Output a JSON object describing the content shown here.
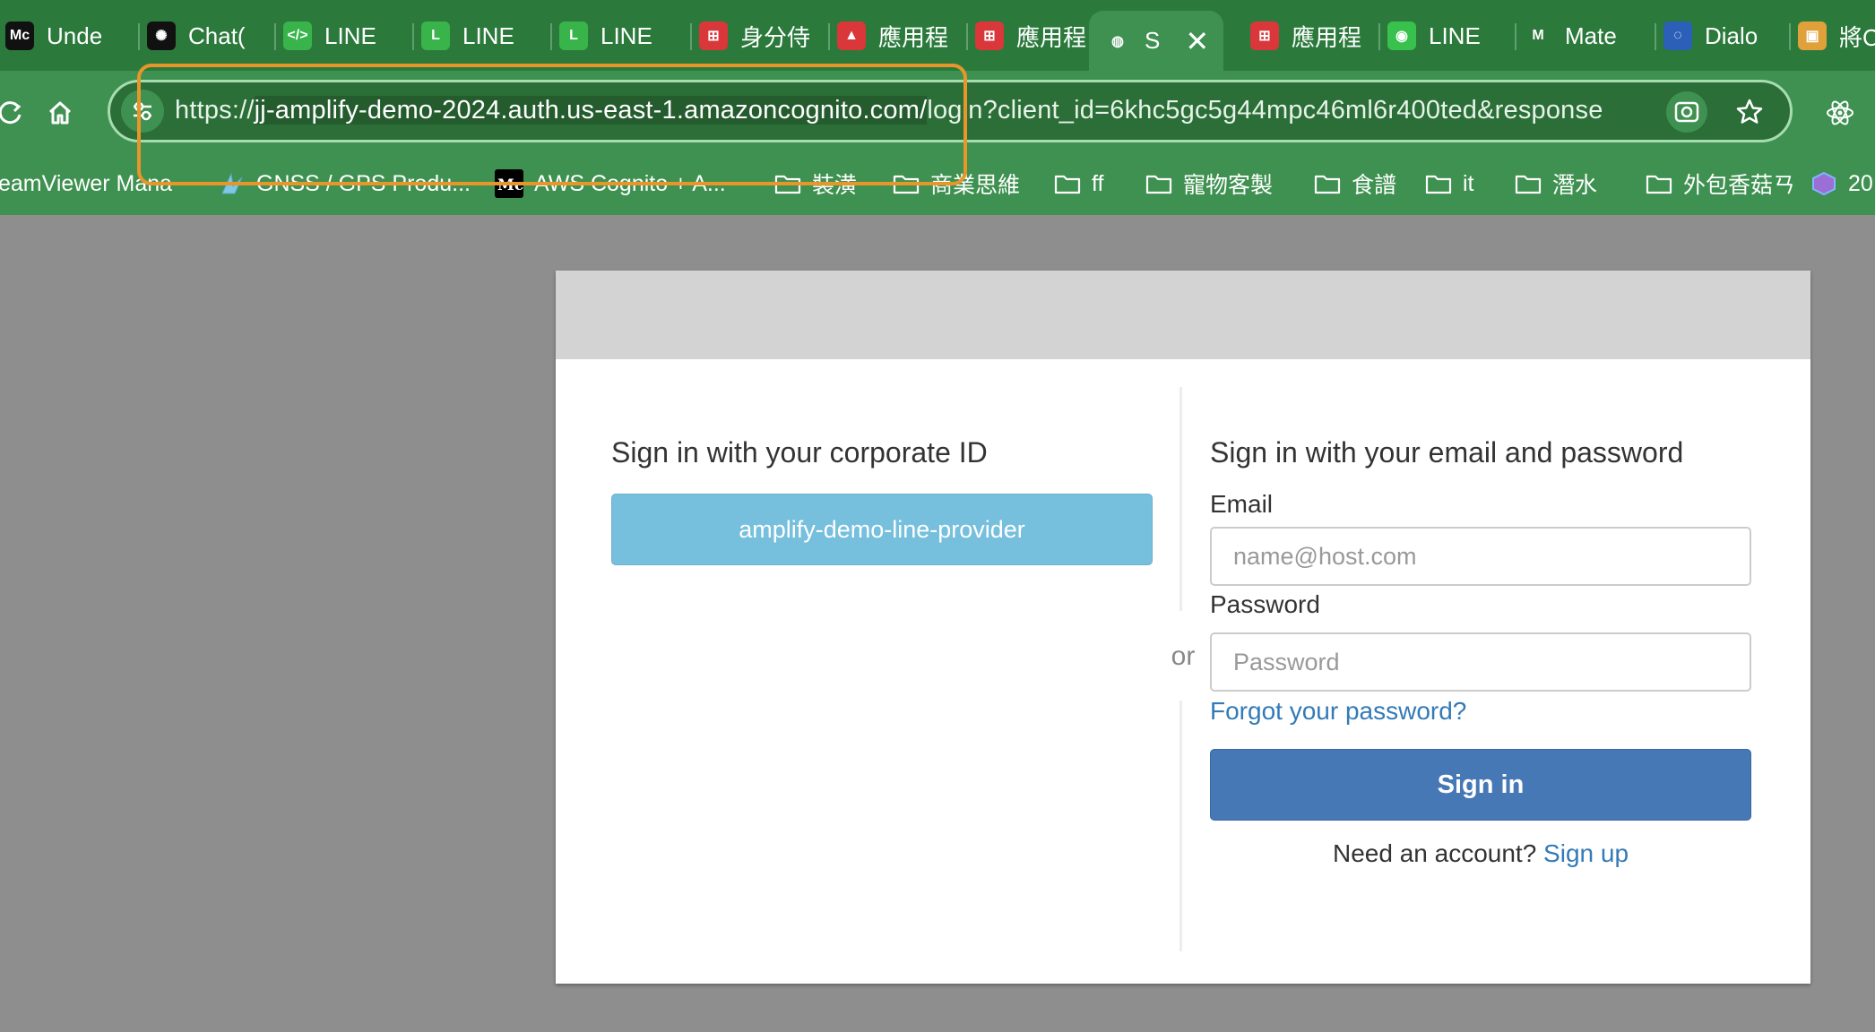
{
  "browser": {
    "tabs": [
      {
        "label": "Unde",
        "icon": "medium-icon",
        "icon_text": "Mc",
        "icon_bg": "#111111"
      },
      {
        "label": "Chat(",
        "icon": "chatgpt-icon",
        "icon_text": "✺",
        "icon_bg": "#111111"
      },
      {
        "label": "LINE",
        "icon": "line-dev-code-icon",
        "icon_text": "</>",
        "icon_bg": "#38b44a"
      },
      {
        "label": "LINE",
        "icon": "line-shield-icon",
        "icon_text": "L",
        "icon_bg": "#38b44a"
      },
      {
        "label": "LINE",
        "icon": "line-shield-icon",
        "icon_text": "L",
        "icon_bg": "#38b44a"
      },
      {
        "label": "身分侍",
        "icon": "app-red-icon",
        "icon_text": "⊞",
        "icon_bg": "#d9373a"
      },
      {
        "label": "應用程",
        "icon": "amplify-icon",
        "icon_text": "▲",
        "icon_bg": "#d9373a"
      },
      {
        "label": "應用程",
        "icon": "app-red-icon",
        "icon_text": "⊞",
        "icon_bg": "#d9373a"
      },
      {
        "label": "S",
        "icon": "globe-icon",
        "icon_text": "◍",
        "icon_bg": "transparent",
        "active": true
      },
      {
        "label": "應用程",
        "icon": "app-red-icon",
        "icon_text": "⊞",
        "icon_bg": "#d9373a"
      },
      {
        "label": "LINE",
        "icon": "line-chat-icon",
        "icon_text": "◉",
        "icon_bg": "#38c14c"
      },
      {
        "label": "Mate",
        "icon": "material-icon",
        "icon_text": "M",
        "icon_bg": "#2b7a3c"
      },
      {
        "label": "Dialo",
        "icon": "dialogflow-icon",
        "icon_text": "◌",
        "icon_bg": "#2c5fb8"
      },
      {
        "label": "將C",
        "icon": "package-icon",
        "icon_text": "▣",
        "icon_bg": "#e0a13a"
      }
    ],
    "close_glyph": "✕",
    "url_prefix": "https://",
    "url_host": "jj-amplify-demo-2024.auth.us-east-1.amazoncognito.com/",
    "url_rest": "login?client_id=6khc5gc5g44mpc46ml6r400ted&response",
    "bookmarks": [
      {
        "label": "eamViewer Mana",
        "icon": "none"
      },
      {
        "label": "GNSS / GPS Produ...",
        "icon": "gnss-icon"
      },
      {
        "label": "AWS Cognito + A...",
        "icon": "medium-icon"
      },
      {
        "label": "裝潢",
        "icon": "folder-icon"
      },
      {
        "label": "商業思維",
        "icon": "folder-icon"
      },
      {
        "label": "ff",
        "icon": "folder-icon"
      },
      {
        "label": "寵物客製",
        "icon": "folder-icon"
      },
      {
        "label": "食譜",
        "icon": "folder-icon"
      },
      {
        "label": "it",
        "icon": "folder-icon"
      },
      {
        "label": "潛水",
        "icon": "folder-icon"
      },
      {
        "label": "外包香菇ㄢ",
        "icon": "folder-icon"
      },
      {
        "label": "20",
        "icon": "cube-icon"
      }
    ]
  },
  "signin": {
    "corporate_heading": "Sign in with your corporate ID",
    "provider_button": "amplify-demo-line-provider",
    "or": "or",
    "email_heading": "Sign in with your email and password",
    "email_label": "Email",
    "email_placeholder": "name@host.com",
    "password_label": "Password",
    "password_placeholder": "Password",
    "forgot": "Forgot your password?",
    "signin_button": "Sign in",
    "need_account": "Need an account?",
    "signup": "Sign up"
  },
  "colors": {
    "chrome_green": "#3e9150",
    "highlight": "#e8952a",
    "provider_blue": "#76bfdd",
    "signin_blue": "#4578b4",
    "link_blue": "#337ab7"
  }
}
